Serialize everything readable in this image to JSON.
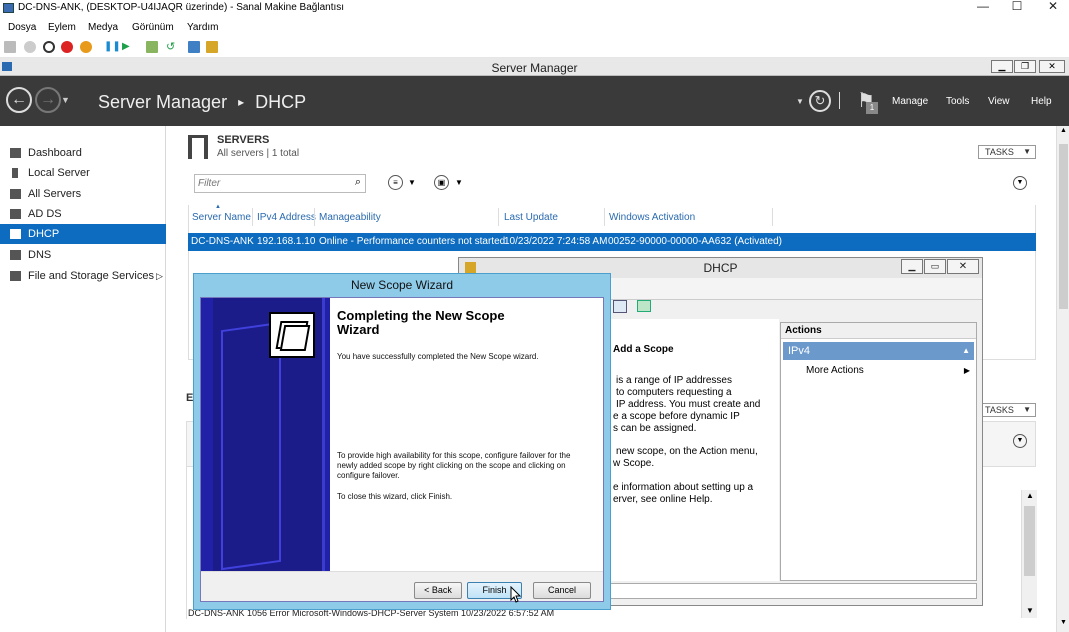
{
  "vm": {
    "title": "DC-DNS-ANK, (DESKTOP-U4IJAQR üzerinde) - Sanal Makine Bağlantısı",
    "menu": [
      "Dosya",
      "Eylem",
      "Medya",
      "Görünüm",
      "Yardım"
    ]
  },
  "sm": {
    "window_title": "Server Manager",
    "breadcrumb_root": "Server Manager",
    "breadcrumb_sep": "▸",
    "breadcrumb_page": "DHCP",
    "flag_count": "1",
    "menu": [
      "Manage",
      "Tools",
      "View",
      "Help"
    ]
  },
  "sidebar": {
    "items": [
      {
        "label": "Dashboard",
        "icon": "dashboard-icon"
      },
      {
        "label": "Local Server",
        "icon": "server-icon"
      },
      {
        "label": "All Servers",
        "icon": "servers-icon"
      },
      {
        "label": "AD DS",
        "icon": "adds-icon"
      },
      {
        "label": "DHCP",
        "icon": "dhcp-icon",
        "selected": true
      },
      {
        "label": "DNS",
        "icon": "dns-icon"
      },
      {
        "label": "File and Storage Services",
        "icon": "storage-icon"
      }
    ]
  },
  "servers": {
    "title": "SERVERS",
    "subtitle": "All servers | 1 total",
    "tasks": "TASKS",
    "filter_placeholder": "Filter",
    "columns": [
      "Server Name",
      "IPv4 Address",
      "Manageability",
      "Last Update",
      "Windows Activation"
    ],
    "row": [
      "DC-DNS-ANK",
      "192.168.1.10",
      "Online - Performance counters not started",
      "10/23/2022 7:24:58 AM",
      "00252-90000-00000-AA632 (Activated)"
    ]
  },
  "events": {
    "tasks": "TASKS",
    "partial_heading": "EV",
    "bottom_row": "DC-DNS-ANK   1056   Error   Microsoft-Windows-DHCP-Server   System   10/23/2022 6:57:52 AM"
  },
  "dhcp": {
    "title": "DHCP",
    "add_scope_heading": "Add a Scope",
    "info_lines": [
      "is a range of IP addresses",
      "to computers requesting a",
      "IP address. You must create and",
      "e a scope before dynamic IP",
      "s can be assigned.",
      "",
      "new scope, on the Action menu,",
      "w Scope.",
      "",
      "e information about setting up a",
      "erver, see online Help."
    ],
    "actions_header": "Actions",
    "actions_section": "IPv4",
    "more_actions": "More Actions"
  },
  "wizard": {
    "title": "New Scope Wizard",
    "heading": "Completing the New Scope Wizard",
    "line1": "You have successfully completed the New Scope wizard.",
    "line2": "To provide high availability for this scope, configure failover for the newly added scope by right clicking on the scope and clicking on configure failover.",
    "line3": "To close this wizard, click Finish.",
    "back": "< Back",
    "finish": "Finish",
    "cancel": "Cancel"
  },
  "colors": {
    "selection": "#0e6cc0",
    "header_bg": "#3a3a3a",
    "wizard_side": "#2121a8",
    "wizard_frame": "#8ecbe8"
  }
}
